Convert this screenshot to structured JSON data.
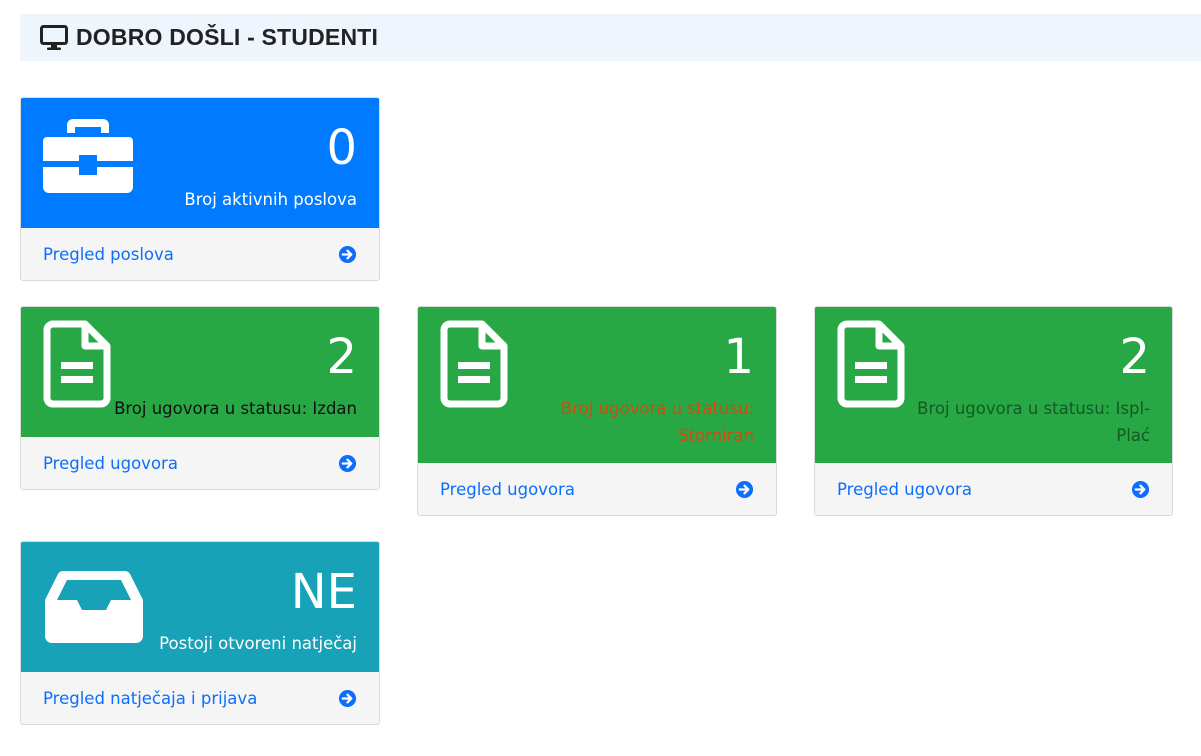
{
  "header": {
    "title": "DOBRO DOŠLI - STUDENTI",
    "icon": "monitor-icon"
  },
  "colors": {
    "blue": "#007bff",
    "green": "#28a745",
    "teal": "#17a2b8",
    "link": "#0d6efd",
    "label_red": "#d9480f",
    "label_dark_green": "#145a25"
  },
  "cards": [
    {
      "icon": "briefcase-icon",
      "count": "0",
      "label": "Broj aktivnih poslova",
      "link": "Pregled poslova"
    },
    {
      "icon": "document-icon",
      "count": "2",
      "label": "Broj ugovora u statusu: Izdan",
      "link": "Pregled ugovora"
    },
    {
      "icon": "document-icon",
      "count": "1",
      "label_line1": "Broj ugovora u statusu:",
      "label_line2": "Storniran",
      "link": "Pregled ugovora"
    },
    {
      "icon": "document-icon",
      "count": "2",
      "label_line1": "Broj ugovora u statusu: Ispl-",
      "label_line2": "Plać",
      "link": "Pregled ugovora"
    },
    {
      "icon": "inbox-icon",
      "count": "NE",
      "label": "Postoji otvoreni natječaj",
      "link": "Pregled natječaja i prijava"
    }
  ]
}
